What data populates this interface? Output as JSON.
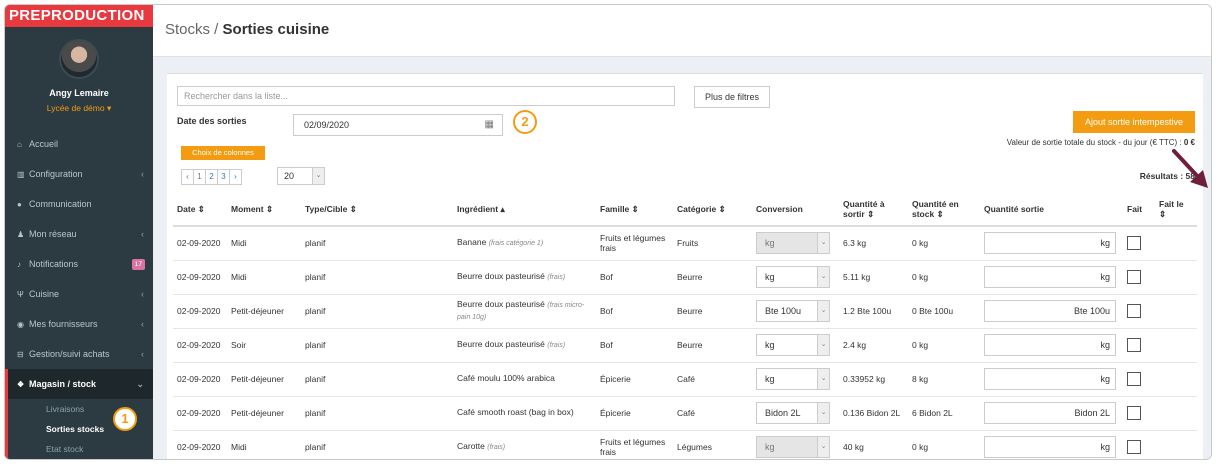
{
  "sidebar": {
    "brand": "PREPRODUCTION",
    "user_name": "Angy Lemaire",
    "school": "Lycée de démo ▾",
    "items": [
      {
        "label": "Accueil",
        "icon": "home-icon",
        "glyph": "⌂",
        "chev": ""
      },
      {
        "label": "Configuration",
        "icon": "bank-icon",
        "glyph": "▥",
        "chev": "‹"
      },
      {
        "label": "Communication",
        "icon": "chat-icon",
        "glyph": "●",
        "chev": ""
      },
      {
        "label": "Mon réseau",
        "icon": "users-icon",
        "glyph": "♟",
        "chev": "‹"
      },
      {
        "label": "Notifications",
        "icon": "bell-icon",
        "glyph": "♪",
        "badge": "17"
      },
      {
        "label": "Cuisine",
        "icon": "cutlery-icon",
        "glyph": "Ψ",
        "chev": "‹"
      },
      {
        "label": "Mes fournisseurs",
        "icon": "eye-icon",
        "glyph": "◉",
        "chev": "‹"
      },
      {
        "label": "Gestion/suivi achats",
        "icon": "cart-icon",
        "glyph": "⊟",
        "chev": "‹"
      },
      {
        "label": "Magasin / stock",
        "icon": "cubes-icon",
        "glyph": "❖",
        "chev": "⌄"
      }
    ],
    "sub_items": [
      "Livraisons",
      "Sorties stocks",
      "Etat stock"
    ],
    "marker_1": "1"
  },
  "header": {
    "crumb": "Stocks / ",
    "title": "Sorties cuisine"
  },
  "toolbar": {
    "search_placeholder": "Rechercher dans la liste...",
    "more_filters": "Plus de filtres",
    "date_label": "Date des sorties",
    "date_value": "02/09/2020",
    "marker_2": "2",
    "add_button": "Ajout sortie intempestive",
    "value_label": "Valeur de sortie totale du stock - du jour (€ TTC) : ",
    "value_amount": "0 €",
    "columns_button": "Choix de colonnes",
    "pager": [
      "‹",
      "1",
      "2",
      "3",
      "›"
    ],
    "page_size": "20",
    "results": "Résultats : 58"
  },
  "table": {
    "headers": [
      "Date ⇕",
      "Moment ⇕",
      "Type/Cible ⇕",
      "Ingrédient ▴",
      "Famille ⇕",
      "Catégorie ⇕",
      "Conversion",
      "Quantité à sortir ⇕",
      "Quantité en stock ⇕",
      "Quantité sortie",
      "Fait",
      "Fait le ⇕"
    ],
    "rows": [
      {
        "date": "02-09-2020",
        "moment": "Midi",
        "type": "planif",
        "ingredient": "Banane",
        "note": "(frais catégorie 1)",
        "famille": "Fruits et légumes frais",
        "categorie": "Fruits",
        "conversion": "kg",
        "disabled": true,
        "a_sortir": "6.3 kg",
        "en_stock": "0 kg",
        "unit": "kg"
      },
      {
        "date": "02-09-2020",
        "moment": "Midi",
        "type": "planif",
        "ingredient": "Beurre doux pasteurisé",
        "note": "(frais)",
        "famille": "Bof",
        "categorie": "Beurre",
        "conversion": "kg",
        "disabled": false,
        "a_sortir": "5.11 kg",
        "en_stock": "0 kg",
        "unit": "kg"
      },
      {
        "date": "02-09-2020",
        "moment": "Petit-déjeuner",
        "type": "planif",
        "ingredient": "Beurre doux pasteurisé",
        "note": "(frais micro-pain 10g)",
        "famille": "Bof",
        "categorie": "Beurre",
        "conversion": "Bte 100u",
        "disabled": false,
        "a_sortir": "1.2 Bte 100u",
        "en_stock": "0 Bte 100u",
        "unit": "Bte 100u"
      },
      {
        "date": "02-09-2020",
        "moment": "Soir",
        "type": "planif",
        "ingredient": "Beurre doux pasteurisé",
        "note": "(frais)",
        "famille": "Bof",
        "categorie": "Beurre",
        "conversion": "kg",
        "disabled": false,
        "a_sortir": "2.4 kg",
        "en_stock": "0 kg",
        "unit": "kg"
      },
      {
        "date": "02-09-2020",
        "moment": "Petit-déjeuner",
        "type": "planif",
        "ingredient": "Café moulu 100% arabica",
        "note": "",
        "famille": "Épicerie",
        "categorie": "Café",
        "conversion": "kg",
        "disabled": false,
        "a_sortir": "0.33952 kg",
        "en_stock": "8 kg",
        "unit": "kg"
      },
      {
        "date": "02-09-2020",
        "moment": "Petit-déjeuner",
        "type": "planif",
        "ingredient": "Café smooth roast (bag in box)",
        "note": "",
        "famille": "Épicerie",
        "categorie": "Café",
        "conversion": "Bidon 2L",
        "disabled": false,
        "a_sortir": "0.136 Bidon 2L",
        "en_stock": "6 Bidon 2L",
        "unit": "Bidon 2L"
      },
      {
        "date": "02-09-2020",
        "moment": "Midi",
        "type": "planif",
        "ingredient": "Carotte",
        "note": "(frais)",
        "famille": "Fruits et légumes frais",
        "categorie": "Légumes",
        "conversion": "kg",
        "disabled": true,
        "a_sortir": "40 kg",
        "en_stock": "0 kg",
        "unit": "kg"
      }
    ]
  },
  "colors": {
    "brand": "#e8393f",
    "accent": "#f39c12",
    "sidebar": "#2c3b41",
    "arrow": "#6d1f3c"
  }
}
